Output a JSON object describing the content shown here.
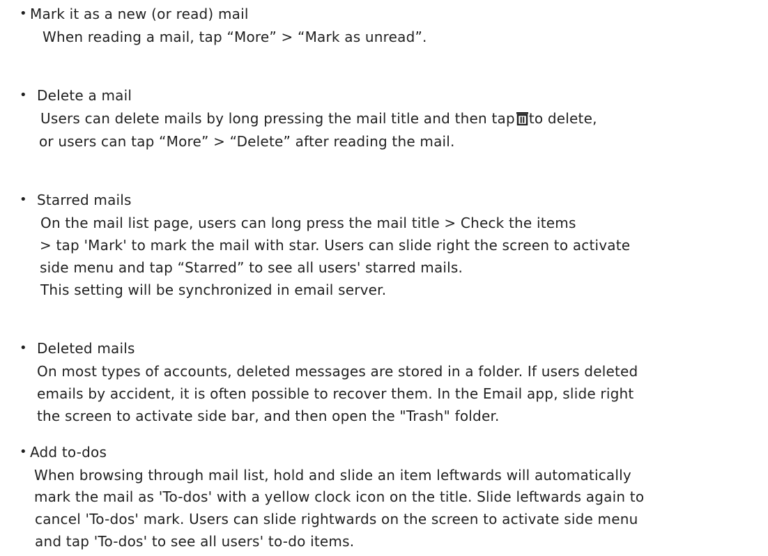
{
  "sections": [
    {
      "heading": "Mark it as a new (or read) mail",
      "lines": [
        "When reading a mail, tap “More” > “Mark as unread”."
      ]
    },
    {
      "heading": "Delete a mail",
      "lines": [
        "Users can delete mails by long pressing the mail title and then tap",
        "to delete,",
        "or users can tap “More” > “Delete” after reading the mail."
      ],
      "icon": "trash-icon"
    },
    {
      "heading": "Starred mails",
      "lines": [
        "On the mail list page, users can long press the mail title > Check the items",
        "> tap 'Mark' to mark the mail with star. Users can slide right the screen to activate",
        "side menu and tap “Starred” to see all users' starred mails.",
        "This setting will be synchronized in email server."
      ]
    },
    {
      "heading": "Deleted mails",
      "lines": [
        "On most types of accounts, deleted messages are stored in a folder. If users deleted",
        "emails by accident, it is often possible to recover them. In the Email app, slide right",
        "the screen to activate side bar, and then open the \"Trash\" folder."
      ]
    },
    {
      "heading": "Add to-dos",
      "lines": [
        "When browsing through mail list, hold and slide an item leftwards will automatically",
        "mark the mail as 'To-dos' with a yellow clock icon on the title. Slide leftwards again to",
        "cancel 'To-dos' mark. Users can slide rightwards on the screen to activate side menu",
        "and tap 'To-dos' to see all users' to-do items."
      ]
    }
  ],
  "bullet_char": "•"
}
